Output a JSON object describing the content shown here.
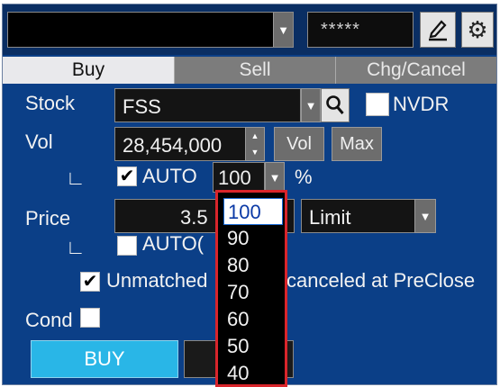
{
  "header": {
    "account_value": "",
    "pin_value": "*****"
  },
  "tabs": [
    {
      "label": "Buy",
      "active": true
    },
    {
      "label": "Sell",
      "active": false
    },
    {
      "label": "Chg/Cancel",
      "active": false
    }
  ],
  "form": {
    "stock_label": "Stock",
    "stock_value": "FSS",
    "nvdr_label": "NVDR",
    "nvdr_checked": false,
    "vol_label": "Vol",
    "vol_value": "28,454,000",
    "vol_button": "Vol",
    "max_button": "Max",
    "auto_label": "AUTO",
    "auto_checked": true,
    "pct_value": "100",
    "pct_sign": "%",
    "price_label": "Price",
    "price_value": "3.5",
    "order_type": "Limit",
    "auto2_label": "AUTO(",
    "auto2_checked": false,
    "unmatched_label": "Unmatched",
    "canceled_label": "canceled at PreClose",
    "unmatched_checked": true,
    "cond_label": "Cond",
    "cond_checked": false,
    "buy_button": "BUY"
  },
  "pct_dropdown": {
    "open": true,
    "selected": "100",
    "options": [
      "100",
      "90",
      "80",
      "70",
      "60",
      "50",
      "40"
    ]
  },
  "colors": {
    "panel": "#0b3f87",
    "buy_button": "#29b6e7",
    "highlight_border": "#d9252b"
  },
  "icons": {
    "edit": "edit-icon",
    "settings": "gear-icon",
    "search": "search-icon",
    "dropdown": "chevron-down-icon"
  }
}
